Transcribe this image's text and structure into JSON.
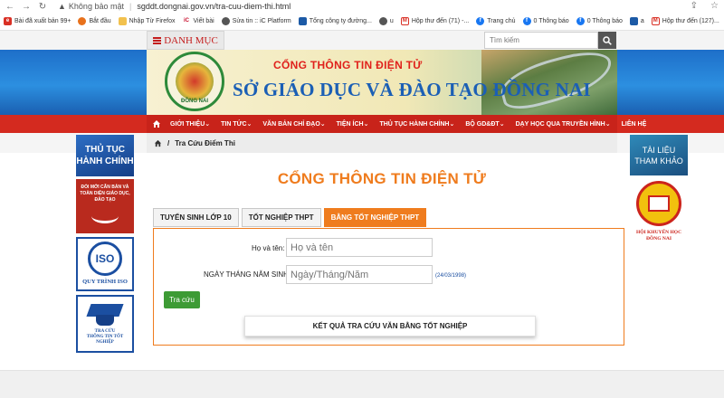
{
  "browser": {
    "security_label": "Không bảo mật",
    "url": "sgddt.dongnai.gov.vn/tra-cuu-diem-thi.html",
    "bookmarks": [
      {
        "label": "Bài đã xuất bản 99+",
        "color": "#d93025",
        "icon": "e-icon"
      },
      {
        "label": "Bắt đầu",
        "color": "#e8711c",
        "icon": "firefox-icon"
      },
      {
        "label": "Nhập Từ Firefox",
        "color": "#f2c14e",
        "icon": "folder-icon"
      },
      {
        "label": "Viết bài",
        "color": "#c8102e",
        "icon": "ic-icon"
      },
      {
        "label": "Sửa tin :: iC Platform",
        "color": "#555555",
        "icon": "globe-icon"
      },
      {
        "label": "Tổng công ty đường...",
        "color": "#1c5aa6",
        "icon": "company-icon"
      },
      {
        "label": "u",
        "color": "#555555",
        "icon": "globe-icon"
      },
      {
        "label": "Hộp thư đến (71) -...",
        "color": "#d93025",
        "icon": "gmail-icon"
      },
      {
        "label": "Trang chủ",
        "color": "#1877f2",
        "icon": "facebook-icon"
      },
      {
        "label": "0 Thông báo",
        "color": "#1877f2",
        "icon": "facebook-icon"
      },
      {
        "label": "0 Thông báo",
        "color": "#1877f2",
        "icon": "facebook-icon"
      },
      {
        "label": "a",
        "color": "#1c5aa6",
        "icon": "company-icon"
      },
      {
        "label": "Hộp thư đến (127)...",
        "color": "#d93025",
        "icon": "gmail-icon"
      }
    ]
  },
  "topbar": {
    "menu_label": "DANH MỤC",
    "search_placeholder": "Tìm kiếm"
  },
  "banner": {
    "subtitle": "CỔNG THÔNG TIN ĐIỆN TỬ",
    "title": "SỞ GIÁO DỤC VÀ ĐÀO TẠO ĐỒNG NAI",
    "logo_text": "ĐỒNG NAI"
  },
  "nav": {
    "items": [
      {
        "label": "GIỚI THIỆU"
      },
      {
        "label": "TIN TỨC"
      },
      {
        "label": "VĂN BẢN CHỈ ĐẠO"
      },
      {
        "label": "TIỆN ÍCH"
      },
      {
        "label": "THỦ TỤC HÀNH CHÍNH"
      },
      {
        "label": "BỘ GD&ĐT"
      },
      {
        "label": "DẠY HỌC QUA TRUYỀN HÌNH"
      },
      {
        "label": "LIÊN HỆ"
      }
    ],
    "colors": {
      "bar": "#d42a1f",
      "inner": "#c8231a"
    }
  },
  "breadcrumb": {
    "current": "Tra Cứu Điểm Thi"
  },
  "sidebar_left": {
    "thutuc_line1": "THỦ TỤC",
    "thutuc_line2": "HÀNH CHÍNH",
    "doimoi_text": "ĐỔI MỚI CĂN BẢN VÀ TOÀN DIỆN GIÁO DỤC, ĐÀO TẠO",
    "iso_text": "ISO",
    "iso_label": "QUY TRÌNH ISO",
    "tracuu_line1": "TRA CỨU",
    "tracuu_line2": "THÔNG TIN TỐT NGHIỆP"
  },
  "sidebar_right": {
    "tailieu_line1": "TÀI LIỆU",
    "tailieu_line2": "THAM KHẢO",
    "khuyenhoc_line1": "HỘI KHUYẾN HỌC",
    "khuyenhoc_line2": "ĐỒNG NAI"
  },
  "main": {
    "title": "CỔNG THÔNG TIN ĐIỆN TỬ",
    "tabs": [
      {
        "label": "TUYỂN SINH LỚP 10",
        "active": false
      },
      {
        "label": "TỐT NGHIỆP THPT",
        "active": false
      },
      {
        "label": "BẰNG TỐT NGHIỆP THPT",
        "active": true
      }
    ],
    "form": {
      "name_label": "Họ và tên:",
      "name_placeholder": "Họ và tên",
      "dob_label": "NGÀY THÁNG NĂM SINH:",
      "dob_placeholder": "Ngày/Tháng/Năm",
      "dob_hint": "(24/03/1998)",
      "submit_label": "Tra cứu",
      "result_label": "KẾT QUẢ TRA CỨU VĂN BẰNG TỐT NGHIỆP"
    },
    "accent_color": "#ef7c1e"
  }
}
